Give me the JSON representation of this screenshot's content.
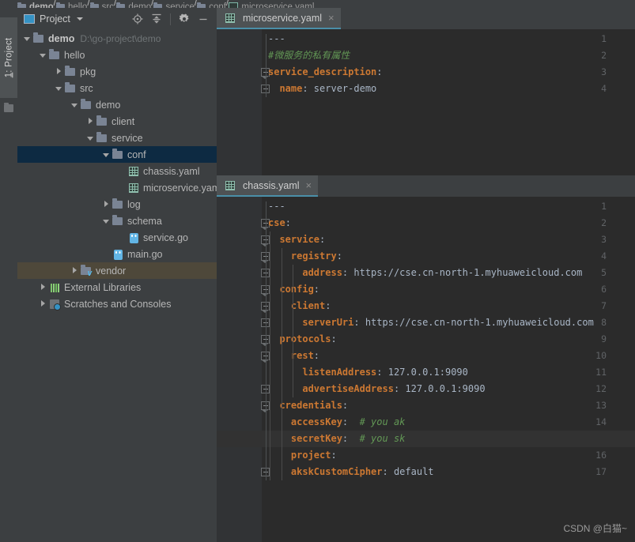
{
  "breadcrumb": {
    "items": [
      {
        "label": "demo",
        "icon": "folder-icon",
        "bold": true
      },
      {
        "label": "hello",
        "icon": "folder-icon",
        "bold": false
      },
      {
        "label": "src",
        "icon": "folder-icon",
        "bold": false
      },
      {
        "label": "demo",
        "icon": "folder-icon",
        "bold": false
      },
      {
        "label": "service",
        "icon": "folder-icon",
        "bold": false
      },
      {
        "label": "conf",
        "icon": "folder-icon",
        "bold": false
      },
      {
        "label": "microservice.yaml",
        "icon": "yaml-file-icon",
        "bold": false
      }
    ]
  },
  "toolwindow_tab": {
    "label": "1: Project",
    "number": "1",
    "name": "Project"
  },
  "project_panel": {
    "title": "Project",
    "dropdown_caret": "chevron-down-icon",
    "tools": [
      {
        "name": "locate-icon",
        "glyph": "target"
      },
      {
        "name": "collapse-all-icon",
        "glyph": "collapse"
      },
      {
        "name": "gear-icon",
        "glyph": "gear"
      },
      {
        "name": "minimize-icon",
        "glyph": "minus"
      }
    ],
    "tree": [
      {
        "label": "demo",
        "path": "D:\\go-project\\demo",
        "depth": 0,
        "arrow": "down",
        "icon": "folder-icon",
        "bold": true,
        "state": "normal"
      },
      {
        "label": "hello",
        "path": "",
        "depth": 1,
        "arrow": "down",
        "icon": "folder-icon",
        "bold": false,
        "state": "normal"
      },
      {
        "label": "pkg",
        "path": "",
        "depth": 2,
        "arrow": "right",
        "icon": "folder-icon",
        "bold": false,
        "state": "normal"
      },
      {
        "label": "src",
        "path": "",
        "depth": 2,
        "arrow": "down",
        "icon": "folder-icon",
        "bold": false,
        "state": "normal"
      },
      {
        "label": "demo",
        "path": "",
        "depth": 3,
        "arrow": "down",
        "icon": "folder-icon",
        "bold": false,
        "state": "normal"
      },
      {
        "label": "client",
        "path": "",
        "depth": 4,
        "arrow": "right",
        "icon": "folder-icon",
        "bold": false,
        "state": "normal"
      },
      {
        "label": "service",
        "path": "",
        "depth": 4,
        "arrow": "down",
        "icon": "folder-icon",
        "bold": false,
        "state": "normal"
      },
      {
        "label": "conf",
        "path": "",
        "depth": 5,
        "arrow": "down",
        "icon": "folder-icon",
        "bold": false,
        "state": "selected"
      },
      {
        "label": "chassis.yaml",
        "path": "",
        "depth": 6,
        "arrow": "none",
        "icon": "yaml-file-icon",
        "bold": false,
        "state": "normal"
      },
      {
        "label": "microservice.yaml",
        "path": "",
        "depth": 6,
        "arrow": "none",
        "icon": "yaml-file-icon",
        "bold": false,
        "state": "normal"
      },
      {
        "label": "log",
        "path": "",
        "depth": 5,
        "arrow": "right",
        "icon": "folder-icon",
        "bold": false,
        "state": "normal"
      },
      {
        "label": "schema",
        "path": "",
        "depth": 5,
        "arrow": "down",
        "icon": "folder-icon",
        "bold": false,
        "state": "normal"
      },
      {
        "label": "service.go",
        "path": "",
        "depth": 6,
        "arrow": "none",
        "icon": "go-file-icon",
        "bold": false,
        "state": "normal"
      },
      {
        "label": "main.go",
        "path": "",
        "depth": 5,
        "arrow": "none",
        "icon": "go-file-icon",
        "bold": false,
        "state": "normal"
      },
      {
        "label": "vendor",
        "path": "",
        "depth": 3,
        "arrow": "right",
        "icon": "vendor-folder-icon",
        "bold": false,
        "state": "hovered"
      },
      {
        "label": "External Libraries",
        "path": "",
        "depth": 1,
        "arrow": "right",
        "icon": "libraries-icon",
        "bold": false,
        "state": "normal"
      },
      {
        "label": "Scratches and Consoles",
        "path": "",
        "depth": 1,
        "arrow": "right",
        "icon": "scratches-icon",
        "bold": false,
        "state": "normal"
      }
    ]
  },
  "editors": {
    "top": {
      "tab": {
        "label": "microservice.yaml",
        "icon": "yaml-file-icon",
        "close": "×"
      },
      "lines": [
        {
          "num": "1",
          "indent": 0,
          "fold": "none",
          "parts": [
            {
              "t": "dash",
              "s": "---"
            }
          ]
        },
        {
          "num": "2",
          "indent": 0,
          "fold": "none",
          "parts": [
            {
              "t": "c",
              "s": "#微服务的私有属性"
            }
          ]
        },
        {
          "num": "3",
          "indent": 0,
          "fold": "open",
          "parts": [
            {
              "t": "k",
              "s": "service_description"
            },
            {
              "t": "v",
              "s": ":"
            }
          ]
        },
        {
          "num": "4",
          "indent": 1,
          "fold": "close",
          "parts": [
            {
              "t": "k",
              "s": "  name"
            },
            {
              "t": "v",
              "s": ": server-demo"
            }
          ]
        }
      ]
    },
    "bottom": {
      "tab": {
        "label": "chassis.yaml",
        "icon": "yaml-file-icon",
        "close": "×"
      },
      "lines": [
        {
          "num": "1",
          "indent": 0,
          "fold": "none",
          "parts": [
            {
              "t": "dash",
              "s": "---"
            }
          ]
        },
        {
          "num": "2",
          "indent": 0,
          "fold": "open",
          "parts": [
            {
              "t": "k",
              "s": "cse"
            },
            {
              "t": "v",
              "s": ":"
            }
          ]
        },
        {
          "num": "3",
          "indent": 1,
          "fold": "open",
          "parts": [
            {
              "t": "k",
              "s": "  service"
            },
            {
              "t": "v",
              "s": ":"
            }
          ]
        },
        {
          "num": "4",
          "indent": 2,
          "fold": "open",
          "parts": [
            {
              "t": "k",
              "s": "    registry"
            },
            {
              "t": "v",
              "s": ":"
            }
          ]
        },
        {
          "num": "5",
          "indent": 3,
          "fold": "close",
          "parts": [
            {
              "t": "k",
              "s": "      address"
            },
            {
              "t": "v",
              "s": ": https://cse.cn-north-1.myhuaweicloud.com"
            }
          ]
        },
        {
          "num": "6",
          "indent": 1,
          "fold": "open",
          "parts": [
            {
              "t": "k",
              "s": "  config"
            },
            {
              "t": "v",
              "s": ":"
            }
          ]
        },
        {
          "num": "7",
          "indent": 2,
          "fold": "open",
          "parts": [
            {
              "t": "k",
              "s": "    client"
            },
            {
              "t": "v",
              "s": ":"
            }
          ]
        },
        {
          "num": "8",
          "indent": 3,
          "fold": "close",
          "parts": [
            {
              "t": "k",
              "s": "      serverUri"
            },
            {
              "t": "v",
              "s": ": https://cse.cn-north-1.myhuaweicloud.com"
            }
          ]
        },
        {
          "num": "9",
          "indent": 1,
          "fold": "open",
          "parts": [
            {
              "t": "k",
              "s": "  protocols"
            },
            {
              "t": "v",
              "s": ":"
            }
          ]
        },
        {
          "num": "10",
          "indent": 2,
          "fold": "open",
          "parts": [
            {
              "t": "k",
              "s": "    rest"
            },
            {
              "t": "v",
              "s": ":"
            }
          ]
        },
        {
          "num": "11",
          "indent": 3,
          "fold": "none",
          "parts": [
            {
              "t": "k",
              "s": "      listenAddress"
            },
            {
              "t": "v",
              "s": ": 127.0.0.1:9090"
            }
          ]
        },
        {
          "num": "12",
          "indent": 3,
          "fold": "close",
          "parts": [
            {
              "t": "k",
              "s": "      advertiseAddress"
            },
            {
              "t": "v",
              "s": ": 127.0.0.1:9090"
            }
          ]
        },
        {
          "num": "13",
          "indent": 1,
          "fold": "open",
          "parts": [
            {
              "t": "k",
              "s": "  credentials"
            },
            {
              "t": "v",
              "s": ":"
            }
          ]
        },
        {
          "num": "14",
          "indent": 2,
          "fold": "none",
          "parts": [
            {
              "t": "k",
              "s": "    accessKey"
            },
            {
              "t": "v",
              "s": ":  "
            },
            {
              "t": "c",
              "s": "# you ak"
            }
          ]
        },
        {
          "num": "15",
          "indent": 2,
          "fold": "none",
          "highlight": true,
          "parts": [
            {
              "t": "k",
              "s": "    secretKey"
            },
            {
              "t": "v",
              "s": ":  "
            },
            {
              "t": "c",
              "s": "# you sk"
            }
          ]
        },
        {
          "num": "16",
          "indent": 2,
          "fold": "none",
          "parts": [
            {
              "t": "k",
              "s": "    project"
            },
            {
              "t": "v",
              "s": ":"
            }
          ]
        },
        {
          "num": "17",
          "indent": 2,
          "fold": "close",
          "parts": [
            {
              "t": "k",
              "s": "    akskCustomCipher"
            },
            {
              "t": "v",
              "s": ": default"
            }
          ]
        }
      ]
    }
  },
  "watermark": "CSDN @白猫~",
  "colors": {
    "background": "#3c3f41",
    "editor_background": "#2b2b2b",
    "gutter_background": "#313335",
    "selection": "#0d2a42",
    "hover": "#4e483a",
    "tab_active_underline": "#4a8fa8",
    "keyword": "#cc7832",
    "comment": "#629755",
    "value": "#a9b6c6"
  }
}
